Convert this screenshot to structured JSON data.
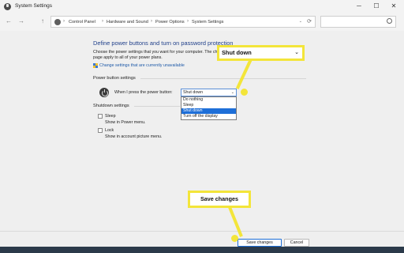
{
  "window": {
    "title": "System Settings",
    "minimize": "─",
    "maximize": "☐",
    "close": "✕"
  },
  "nav": {
    "back": "←",
    "forward": "→",
    "up": "↑"
  },
  "address": {
    "crumbs": [
      "Control Panel",
      "Hardware and Sound",
      "Power Options",
      "System Settings"
    ],
    "separator": "›",
    "drop": "⌄",
    "refresh": "⟳"
  },
  "search": {
    "placeholder": ""
  },
  "main": {
    "heading": "Define power buttons and turn on password protection",
    "description": "Choose the power settings that you want for your computer. The changes you make to the settings on this page apply to all of your power plans.",
    "uac_link": "Change settings that are currently unavailable",
    "power_group_label": "Power button settings",
    "when_label": "When I press the power button:",
    "selected_value": "Shut down",
    "options": [
      "Do nothing",
      "Sleep",
      "Shut down",
      "Turn off the display"
    ],
    "shutdown_group_label": "Shutdown settings",
    "sleep_label": "Sleep",
    "sleep_sub": "Show in Power menu.",
    "lock_label": "Lock",
    "lock_sub": "Show in account picture menu."
  },
  "buttons": {
    "save": "Save changes",
    "cancel": "Cancel"
  },
  "callouts": {
    "dropdown": "Shut down",
    "save": "Save changes",
    "chevron": "⌄"
  },
  "colors": {
    "highlight": "#f3e53a",
    "link": "#1e5aa8",
    "heading": "#1f3f8a",
    "selection": "#1e6fd8"
  }
}
